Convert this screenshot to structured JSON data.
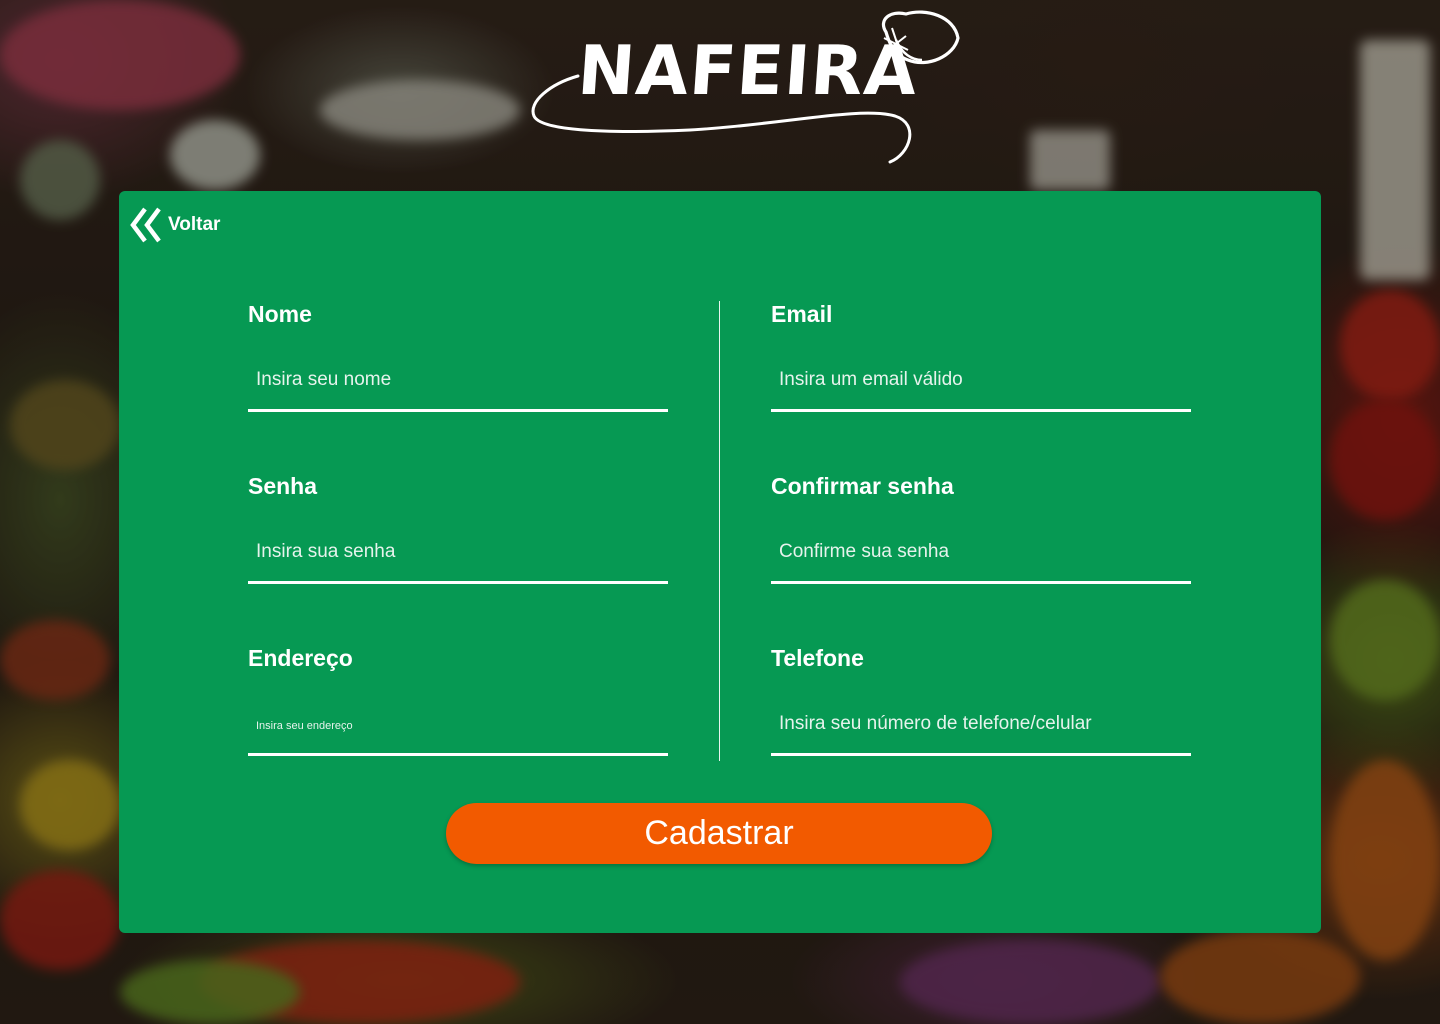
{
  "brand": {
    "name": "NAFEIRA",
    "logo_icon": "lemon-icon"
  },
  "nav": {
    "back_label": "Voltar",
    "back_icon": "double-chevron-left-icon"
  },
  "form": {
    "fields": [
      {
        "label": "Nome",
        "placeholder": "Insira seu nome",
        "value": ""
      },
      {
        "label": "Email",
        "placeholder": "Insira um email válido",
        "value": ""
      },
      {
        "label": "Senha",
        "placeholder": "Insira sua senha",
        "value": ""
      },
      {
        "label": "Confirmar senha",
        "placeholder": "Confirme sua senha",
        "value": ""
      },
      {
        "label": "Endereço",
        "placeholder": "Insira seu endereço",
        "value": ""
      },
      {
        "label": "Telefone",
        "placeholder": "Insira seu número de telefone/celular",
        "value": ""
      }
    ],
    "submit_label": "Cadastrar"
  },
  "colors": {
    "card": "#069953",
    "button": "#f25a00",
    "text": "#ffffff"
  }
}
